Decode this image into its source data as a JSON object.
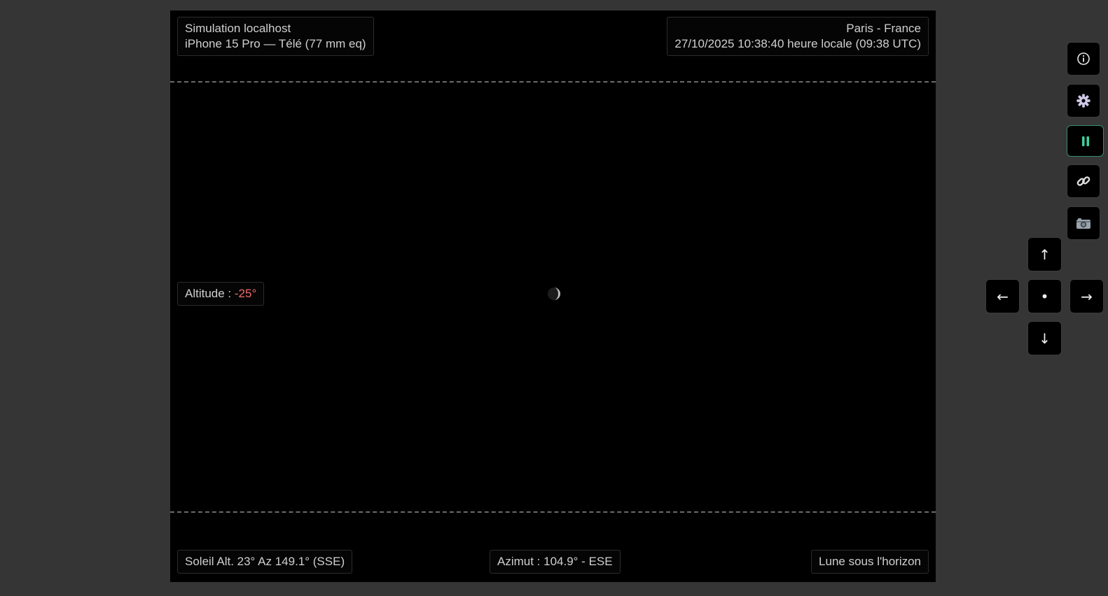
{
  "header": {
    "source": "Simulation localhost",
    "device": "iPhone 15 Pro — Télé (77 mm eq)",
    "location": "Paris - France",
    "datetime": "27/10/2025 10:38:40 heure locale (09:38 UTC)"
  },
  "altitude": {
    "label": "Altitude : ",
    "value": "-25°",
    "value_color": "#ef6b6b"
  },
  "footer": {
    "sun": "Soleil Alt. 23° Az 149.1° (SSE)",
    "azimuth": "Azimut : 104.9° - ESE",
    "moon_status": "Lune sous l'horizon"
  },
  "toolbar": {
    "info_icon": "info-icon",
    "settings_icon": "gear-icon",
    "pause_icon": "pause-icon",
    "pause_active_color": "#3fd0a0",
    "link_icon": "link-icon",
    "camera_icon": "camera-icon"
  },
  "dpad": {
    "up": "↑",
    "left": "←",
    "center": "•",
    "right": "→",
    "down": "↓"
  }
}
